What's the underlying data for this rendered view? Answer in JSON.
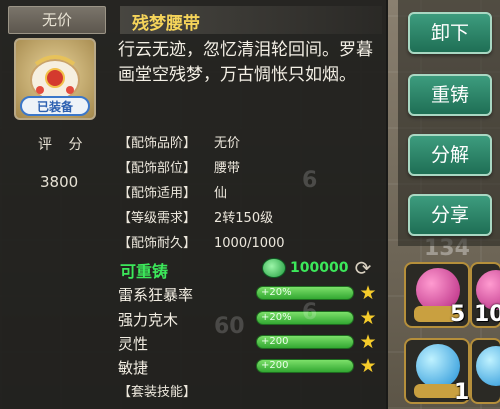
{
  "item": {
    "rank": "无价",
    "name": "残梦腰带",
    "equipped": "已装备",
    "description": "行云无迹，忽忆清泪轮回间。罗暮画堂空残梦，万古惆怅只如烟。"
  },
  "score": {
    "label": "评 分",
    "value": "3800"
  },
  "attributes": [
    {
      "key": "【配饰品阶】",
      "value": "无价"
    },
    {
      "key": "【配饰部位】",
      "value": "腰带"
    },
    {
      "key": "【配饰适用】",
      "value": "仙"
    },
    {
      "key": "【等级需求】",
      "value": "2转150级"
    },
    {
      "key": "【配饰耐久】",
      "value": "1000/1000"
    }
  ],
  "refine": {
    "label": "可重铸",
    "cost": "100000"
  },
  "stats": [
    {
      "name": "雷系狂暴率",
      "bonus": "+20%"
    },
    {
      "name": "强力克木",
      "bonus": "+20%"
    },
    {
      "name": "灵性",
      "bonus": "+200"
    },
    {
      "name": "敏捷",
      "bonus": "+200"
    }
  ],
  "set_label": "【套装技能】",
  "buttons": {
    "unequip": "卸下",
    "recast": "重铸",
    "decompose": "分解",
    "share": "分享"
  },
  "inventory": [
    {
      "count": "5"
    },
    {
      "count": "10"
    },
    {
      "count": "1"
    }
  ],
  "background_numbers": [
    "134",
    "6",
    "60",
    "6"
  ]
}
